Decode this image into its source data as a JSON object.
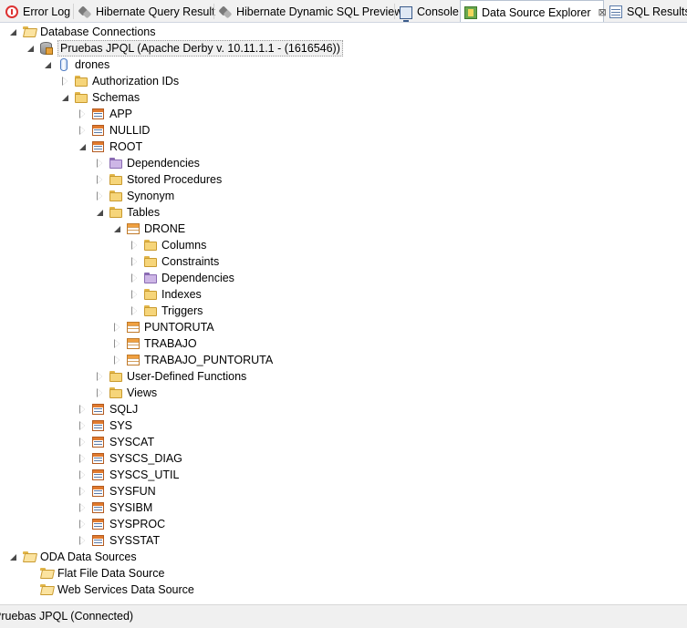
{
  "tabs": [
    {
      "label": "Error Log",
      "icon": "error-log-icon",
      "active": false
    },
    {
      "label": "Hibernate Query Result",
      "icon": "hibernate-icon",
      "active": false
    },
    {
      "label": "Hibernate Dynamic SQL Preview",
      "icon": "hibernate-icon",
      "active": false
    },
    {
      "label": "Console",
      "icon": "console-icon",
      "active": false
    },
    {
      "label": "Data Source Explorer",
      "icon": "data-source-explorer-icon",
      "active": true,
      "close": "⊠"
    },
    {
      "label": "SQL Results",
      "icon": "sql-results-icon",
      "active": false
    }
  ],
  "tree": {
    "database_connections": "Database Connections",
    "connection": "Pruebas JPQL (Apache Derby v. 10.11.1.1 - (1616546))",
    "database": "drones",
    "authorization_ids": "Authorization IDs",
    "schemas": "Schemas",
    "schema_app": "APP",
    "schema_nullid": "NULLID",
    "schema_root": "ROOT",
    "root_children": {
      "dependencies": "Dependencies",
      "stored_procedures": "Stored Procedures",
      "synonym": "Synonym",
      "tables": "Tables",
      "user_defined_functions": "User-Defined Functions",
      "views": "Views"
    },
    "table_drone": "DRONE",
    "drone_children": {
      "columns": "Columns",
      "constraints": "Constraints",
      "dependencies": "Dependencies",
      "indexes": "Indexes",
      "triggers": "Triggers"
    },
    "table_puntoruta": "PUNTORUTA",
    "table_trabajo": "TRABAJO",
    "table_trabajo_puntoruta": "TRABAJO_PUNTORUTA",
    "schemas_more": [
      "SQLJ",
      "SYS",
      "SYSCAT",
      "SYSCS_DIAG",
      "SYSCS_UTIL",
      "SYSFUN",
      "SYSIBM",
      "SYSPROC",
      "SYSSTAT"
    ],
    "oda_data_sources": "ODA Data Sources",
    "flat_file": "Flat File Data Source",
    "web_services": "Web Services Data Source"
  },
  "status": {
    "text": "Pruebas JPQL (Connected)"
  },
  "colors": {
    "tab_active_border": "#b8c3d2",
    "folder": "#f6d57a",
    "status_bg": "#f0f0f0"
  }
}
